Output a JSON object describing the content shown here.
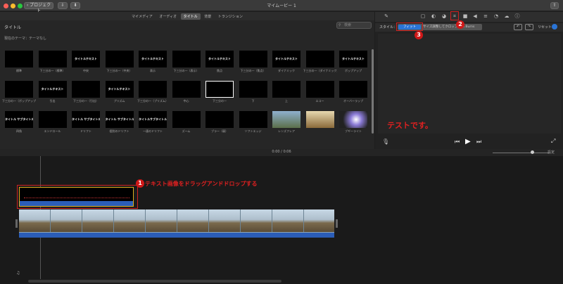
{
  "window": {
    "back_button_label": "プロジェクト",
    "title": "マイムービー 1",
    "settings_label": "設定"
  },
  "media_tabs": [
    "マイメディア",
    "オーディオ",
    "タイトル",
    "背景",
    "トランジション"
  ],
  "active_tab": "タイトル",
  "browser": {
    "heading": "タイトル",
    "search_placeholder": "検索",
    "theme_label": "現在のテーマ：テーマなし"
  },
  "title_thumbnails": [
    {
      "label": "標準",
      "preview": ""
    },
    {
      "label": "下三分の一（標準）",
      "preview": ""
    },
    {
      "label": "中央",
      "preview": "タイトルテキスト"
    },
    {
      "label": "下三分の一（中央）",
      "preview": ""
    },
    {
      "label": "表示",
      "preview": "タイトルテキスト"
    },
    {
      "label": "下三分の一（表示）",
      "preview": ""
    },
    {
      "label": "焦点",
      "preview": "タイトルテキスト"
    },
    {
      "label": "下三分の一（焦点）",
      "preview": ""
    },
    {
      "label": "ダイナミック",
      "preview": "タイトルテキスト"
    },
    {
      "label": "下三分の一（ダイナミック）",
      "preview": ""
    },
    {
      "label": "ポップアップ",
      "preview": "タイトルテキスト"
    },
    {
      "label": "下三分の一（ポップアップ）",
      "preview": ""
    },
    {
      "label": "引出",
      "preview": "タイトルテキスト"
    },
    {
      "label": "下三分の一（引出）",
      "preview": ""
    },
    {
      "label": "プリズム",
      "preview": "タイトルテキスト"
    },
    {
      "label": "下三分の一（プリズム）",
      "preview": ""
    },
    {
      "label": "中心",
      "preview": ""
    },
    {
      "label": "下三分の一",
      "preview": ""
    },
    {
      "label": "下",
      "preview": ""
    },
    {
      "label": "上",
      "preview": ""
    },
    {
      "label": "エコー",
      "preview": ""
    },
    {
      "label": "オーバーラップ",
      "preview": ""
    },
    {
      "label": "四角",
      "preview": "タイトル サブタイトル"
    },
    {
      "label": "エンドロール",
      "preview": ""
    },
    {
      "label": "ドリフト",
      "preview": "タイトル サブタイトル"
    },
    {
      "label": "個別のドリフト",
      "preview": "タイトル サブタイトル"
    },
    {
      "label": "一連のドリフト",
      "preview": "タイトルサブタイトル"
    },
    {
      "label": "ズーム",
      "preview": ""
    },
    {
      "label": "ブラー（弱）",
      "preview": ""
    },
    {
      "label": "ソフトエッジ",
      "preview": ""
    },
    {
      "label": "レンズフレア",
      "preview": ""
    },
    {
      "label": "",
      "preview": ""
    },
    {
      "label": "ブギーライト",
      "preview": ""
    }
  ],
  "viewer": {
    "style_label": "スタイル：",
    "fit_button": "フィット",
    "crop_button": "サイズ調整してクロップ Ken Burns",
    "reset_label": "リセット",
    "overlay_text": "テストです。"
  },
  "timeline": {
    "current_time": "0:00",
    "total_time": "0:06",
    "settings_label": "設定"
  },
  "annotations": {
    "step1": "1",
    "step1_text": "テキスト画像をドラッグアンドドロップする",
    "step2": "2",
    "step3": "3"
  },
  "colors": {
    "accent_blue": "#2a74d6",
    "annotation_red": "#d01818",
    "clip_border": "#e0b020"
  }
}
